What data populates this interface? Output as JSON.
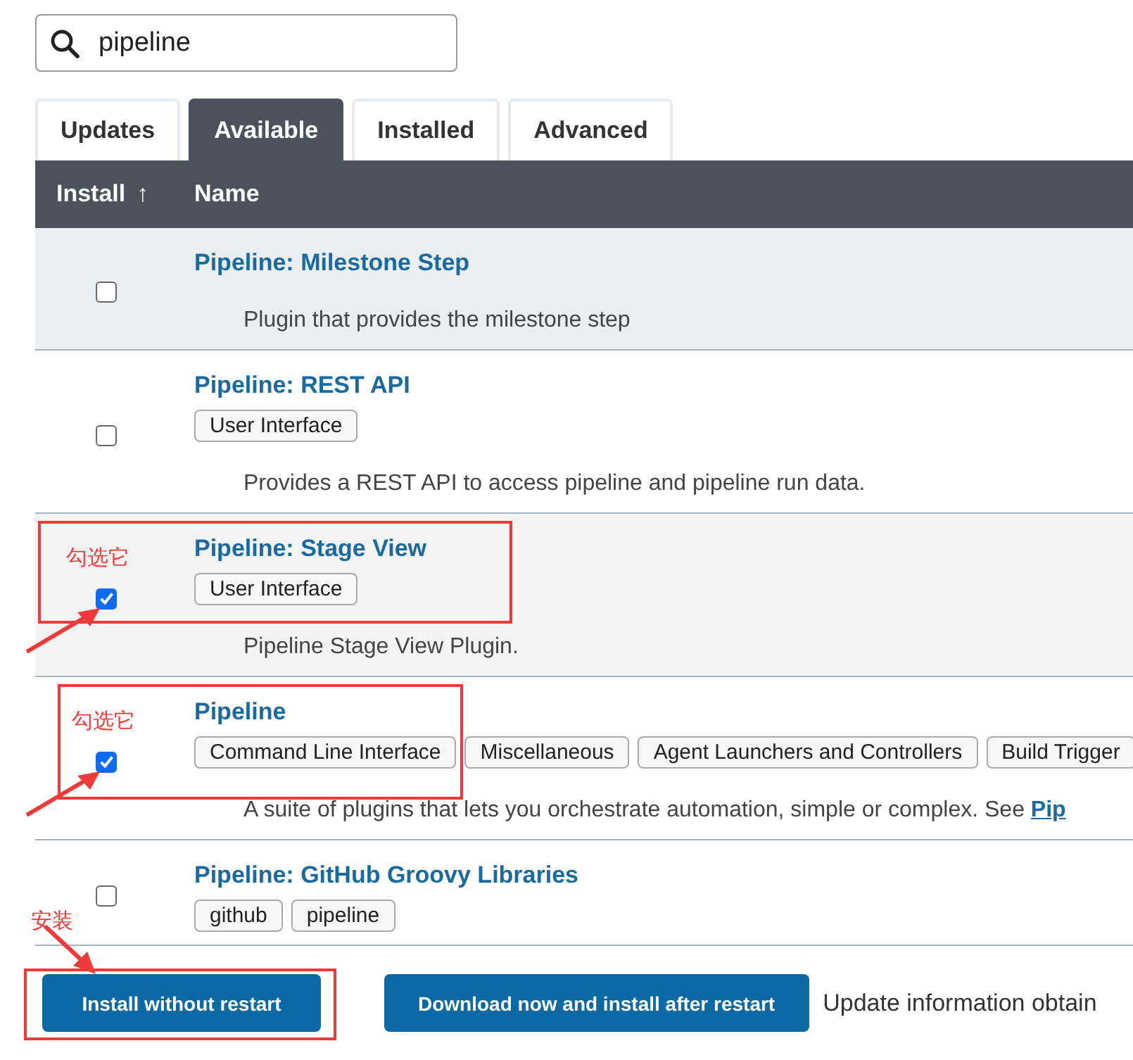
{
  "search": {
    "value": "pipeline"
  },
  "tabs": [
    {
      "label": "Updates",
      "selected": false
    },
    {
      "label": "Available",
      "selected": true
    },
    {
      "label": "Installed",
      "selected": false
    },
    {
      "label": "Advanced",
      "selected": false
    }
  ],
  "table": {
    "columns": [
      {
        "label": "Install",
        "sort": "↑"
      },
      {
        "label": "Name"
      }
    ],
    "rows": [
      {
        "name": "Pipeline: Milestone Step",
        "tags": [],
        "description": "Plugin that provides the milestone step",
        "checked": false,
        "hovered": true,
        "shaded": false
      },
      {
        "name": "Pipeline: REST API",
        "tags": [
          "User Interface"
        ],
        "description": "Provides a REST API to access pipeline and pipeline run data.",
        "checked": false,
        "hovered": false,
        "shaded": false
      },
      {
        "name": "Pipeline: Stage View",
        "tags": [
          "User Interface"
        ],
        "description": "Pipeline Stage View Plugin.",
        "checked": true,
        "hovered": false,
        "shaded": true,
        "annotation": "勾选它"
      },
      {
        "name": "Pipeline",
        "tags": [
          "Command Line Interface",
          "Miscellaneous",
          "Agent Launchers and Controllers",
          "Build Trigger"
        ],
        "description": "A suite of plugins that lets you orchestrate automation, simple or complex. See ",
        "description_link": "Pip",
        "checked": true,
        "hovered": false,
        "shaded": false,
        "annotation": "勾选它"
      },
      {
        "name": "Pipeline: GitHub Groovy Libraries",
        "tags": [
          "github",
          "pipeline"
        ],
        "checked": false,
        "hovered": false,
        "shaded": false
      }
    ]
  },
  "buttons": [
    {
      "label": "Install without restart",
      "annotation": "安装"
    },
    {
      "label": "Download now and install after restart"
    }
  ],
  "footer_text": "Update information obtain"
}
